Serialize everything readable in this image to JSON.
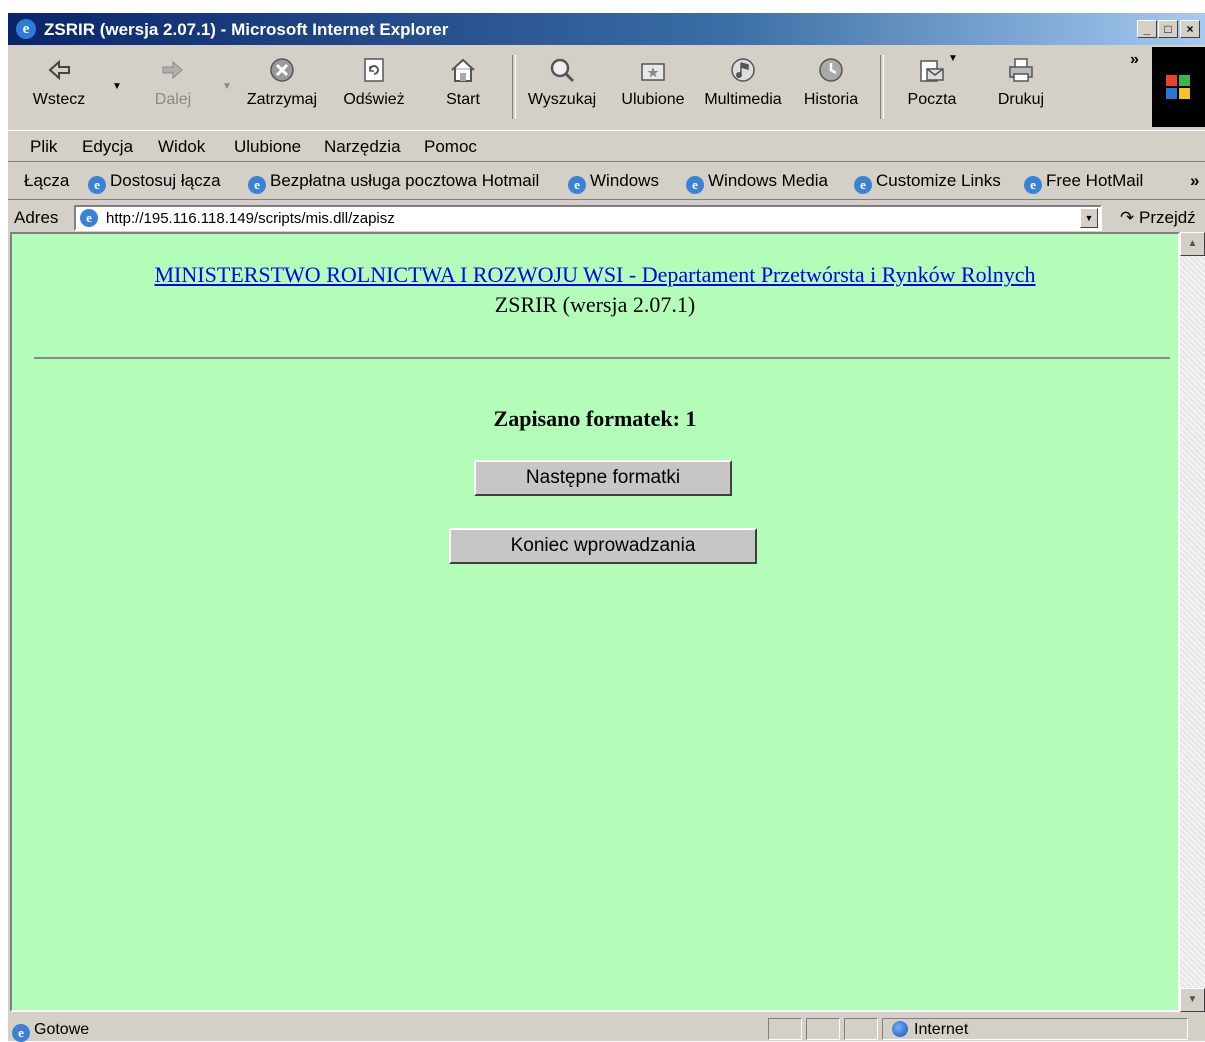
{
  "window": {
    "title": "ZSRIR (wersja 2.07.1) - Microsoft Internet Explorer",
    "min_glyph": "_",
    "max_glyph": "□",
    "close_glyph": "×"
  },
  "toolbar": {
    "back_label": "Wstecz",
    "forward_label": "Dalej",
    "stop_label": "Zatrzymaj",
    "refresh_label": "Odśwież",
    "home_label": "Start",
    "search_label": "Wyszukaj",
    "favorites_label": "Ulubione",
    "media_label": "Multimedia",
    "history_label": "Historia",
    "mail_label": "Poczta",
    "print_label": "Drukuj",
    "more_glyph": "»"
  },
  "menu": {
    "file": "Plik",
    "edit": "Edycja",
    "view": "Widok",
    "favorites": "Ulubione",
    "tools": "Narzędzia",
    "help": "Pomoc"
  },
  "links": {
    "label": "Łącza",
    "items": [
      "Dostosuj łącza",
      "Bezpłatna usługa pocztowa Hotmail",
      "Windows",
      "Windows Media",
      "Customize Links",
      "Free HotMail"
    ],
    "more_glyph": "»"
  },
  "address": {
    "label": "Adres",
    "url": "http://195.116.118.149/scripts/mis.dll/zapisz",
    "go_label": "Przejdź"
  },
  "page": {
    "header_link": "MINISTERSTWO ROLNICTWA I ROZWOJU WSI - Departament Przetwórsta i Rynków Rolnych",
    "subtitle": "ZSRIR (wersja 2.07.1)",
    "saved_text": "Zapisano formatek: 1",
    "next_button": "Następne formatki",
    "end_button": "Koniec wprowadzania"
  },
  "status": {
    "text": "Gotowe",
    "zone": "Internet"
  },
  "colors": {
    "page_background": "#b3fdb9",
    "title_bar": "#0a246a",
    "link": "#0000ee"
  }
}
